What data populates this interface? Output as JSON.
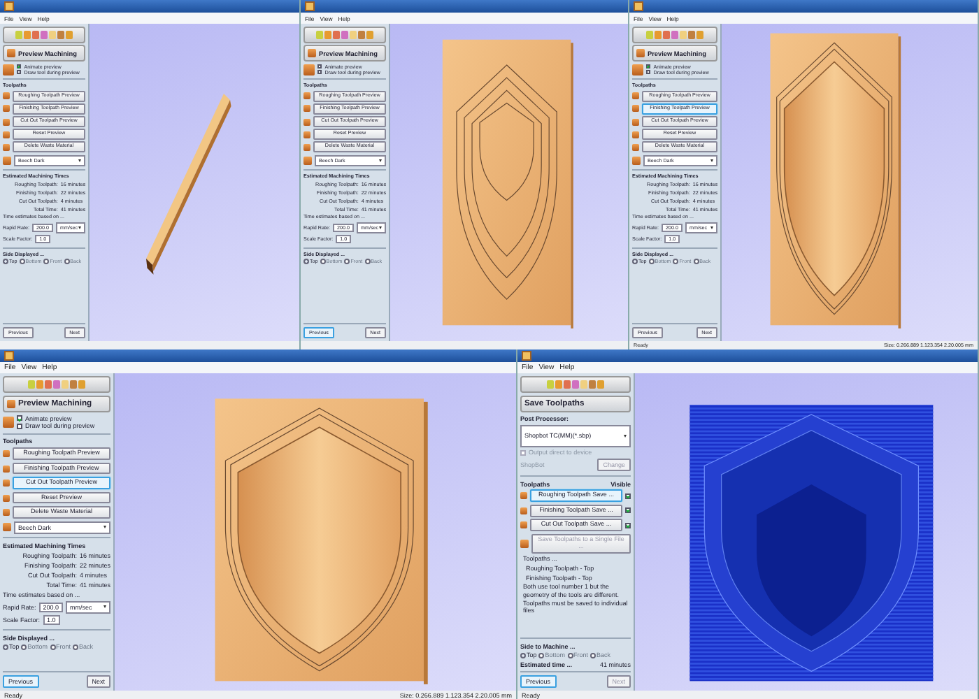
{
  "rows": [
    {
      "screens": [
        {
          "menu": [
            "File",
            "View",
            "Help"
          ],
          "view": {
            "kind": "stick"
          },
          "panel": {
            "kind": "preview",
            "title": "Preview Machining",
            "options": [
              {
                "label": "Animate preview",
                "checked": true
              },
              {
                "label": "Draw tool during preview",
                "checked": false
              }
            ],
            "toolpaths_heading": "Toolpaths",
            "toolpaths": [
              {
                "label": "Roughing Toolpath Preview",
                "selected": false
              },
              {
                "label": "Finishing Toolpath Preview",
                "selected": false
              },
              {
                "label": "Cut Out Toolpath Preview",
                "selected": false
              }
            ],
            "actions": [
              "Reset Preview",
              "Delete Waste Material"
            ],
            "material": "Beech Dark",
            "times_heading": "Estimated Machining Times",
            "times": [
              {
                "label": "Roughing Toolpath:",
                "value": "16 minutes"
              },
              {
                "label": "Finishing Toolpath:",
                "value": "22 minutes"
              },
              {
                "label": "Cut Out Toolpath:",
                "value": "4 minutes"
              },
              {
                "label": "Total Time:",
                "value": "41 minutes"
              }
            ],
            "estimate_note": "Time estimates based on ...",
            "rapid_label": "Rapid Rate:",
            "rapid_value": "200.0",
            "rapid_unit": "mm/sec",
            "scale_label": "Scale Factor:",
            "scale_value": "1.0",
            "sides_heading": "Side Displayed ...",
            "sides": [
              {
                "label": "Top",
                "selected": true
              },
              {
                "label": "Bottom",
                "selected": false
              },
              {
                "label": "Front",
                "selected": false
              },
              {
                "label": "Back",
                "selected": false
              }
            ],
            "buttons": [
              {
                "label": "Previous",
                "focused": false,
                "disabled": false
              },
              {
                "label": "Next",
                "focused": false,
                "disabled": false
              }
            ]
          }
        },
        {
          "menu": [
            "File",
            "View",
            "Help"
          ],
          "view": {
            "kind": "outlines"
          },
          "panel": {
            "kind": "preview",
            "title": "Preview Machining",
            "options": [
              {
                "label": "Animate preview",
                "checked": false
              },
              {
                "label": "Draw tool during preview",
                "checked": false
              }
            ],
            "toolpaths_heading": "Toolpaths",
            "toolpaths": [
              {
                "label": "Roughing Toolpath Preview",
                "selected": false
              },
              {
                "label": "Finishing Toolpath Preview",
                "selected": false
              },
              {
                "label": "Cut Out Toolpath Preview",
                "selected": false
              }
            ],
            "actions": [
              "Reset Preview",
              "Delete Waste Material"
            ],
            "material": "Beech Dark",
            "times_heading": "Estimated Machining Times",
            "times": [
              {
                "label": "Roughing Toolpath:",
                "value": "16 minutes"
              },
              {
                "label": "Finishing Toolpath:",
                "value": "22 minutes"
              },
              {
                "label": "Cut Out Toolpath:",
                "value": "4 minutes"
              },
              {
                "label": "Total Time:",
                "value": "41 minutes"
              }
            ],
            "estimate_note": "Time estimates based on ...",
            "rapid_label": "Rapid Rate:",
            "rapid_value": "200.0",
            "rapid_unit": "mm/sec",
            "scale_label": "Scale Factor:",
            "scale_value": "1.0",
            "sides_heading": "Side Displayed ...",
            "sides": [
              {
                "label": "Top",
                "selected": true
              },
              {
                "label": "Bottom",
                "selected": false
              },
              {
                "label": "Front",
                "selected": false
              },
              {
                "label": "Back",
                "selected": false
              }
            ],
            "buttons": [
              {
                "label": "Previous",
                "focused": true,
                "disabled": false
              },
              {
                "label": "Next",
                "focused": false,
                "disabled": false
              }
            ]
          }
        },
        {
          "menu": [
            "File",
            "View",
            "Help"
          ],
          "view": {
            "kind": "carved"
          },
          "status": {
            "left": "Ready",
            "right": "Size: 0.266.889 1.123.354 2.20.005 mm"
          },
          "panel": {
            "kind": "preview",
            "title": "Preview Machining",
            "options": [
              {
                "label": "Animate preview",
                "checked": true
              },
              {
                "label": "Draw tool during preview",
                "checked": false
              }
            ],
            "toolpaths_heading": "Toolpaths",
            "toolpaths": [
              {
                "label": "Roughing Toolpath Preview",
                "selected": false
              },
              {
                "label": "Finishing Toolpath Preview",
                "selected": true
              },
              {
                "label": "Cut Out Toolpath Preview",
                "selected": false
              }
            ],
            "actions": [
              "Reset Preview",
              "Delete Waste Material"
            ],
            "material": "Beech Dark",
            "times_heading": "Estimated Machining Times",
            "times": [
              {
                "label": "Roughing Toolpath:",
                "value": "16 minutes"
              },
              {
                "label": "Finishing Toolpath:",
                "value": "22 minutes"
              },
              {
                "label": "Cut Out Toolpath:",
                "value": "4 minutes"
              },
              {
                "label": "Total Time:",
                "value": "41 minutes"
              }
            ],
            "estimate_note": "Time estimates based on ...",
            "rapid_label": "Rapid Rate:",
            "rapid_value": "200.0",
            "rapid_unit": "mm/sec",
            "scale_label": "Scale Factor:",
            "scale_value": "1.0",
            "sides_heading": "Side Displayed ...",
            "sides": [
              {
                "label": "Top",
                "selected": true
              },
              {
                "label": "Bottom",
                "selected": false
              },
              {
                "label": "Front",
                "selected": false
              },
              {
                "label": "Back",
                "selected": false
              }
            ],
            "buttons": [
              {
                "label": "Previous",
                "focused": false,
                "disabled": false
              },
              {
                "label": "Next",
                "focused": false,
                "disabled": false
              }
            ]
          }
        }
      ]
    },
    {
      "screens": [
        {
          "menu": [
            "File",
            "View",
            "Help"
          ],
          "view": {
            "kind": "carved"
          },
          "status": {
            "left": "Ready",
            "right": "Size: 0.266.889 1.123.354 2.20.005 mm"
          },
          "panel": {
            "kind": "preview",
            "title": "Preview Machining",
            "options": [
              {
                "label": "Animate preview",
                "checked": true
              },
              {
                "label": "Draw tool during preview",
                "checked": false
              }
            ],
            "toolpaths_heading": "Toolpaths",
            "toolpaths": [
              {
                "label": "Roughing Toolpath Preview",
                "selected": false
              },
              {
                "label": "Finishing Toolpath Preview",
                "selected": false
              },
              {
                "label": "Cut Out Toolpath Preview",
                "selected": true
              }
            ],
            "actions": [
              "Reset Preview",
              "Delete Waste Material"
            ],
            "material": "Beech Dark",
            "times_heading": "Estimated Machining Times",
            "times": [
              {
                "label": "Roughing Toolpath:",
                "value": "16 minutes"
              },
              {
                "label": "Finishing Toolpath:",
                "value": "22 minutes"
              },
              {
                "label": "Cut Out Toolpath:",
                "value": "4 minutes"
              },
              {
                "label": "Total Time:",
                "value": "41 minutes"
              }
            ],
            "estimate_note": "Time estimates based on ...",
            "rapid_label": "Rapid Rate:",
            "rapid_value": "200.0",
            "rapid_unit": "mm/sec",
            "scale_label": "Scale Factor:",
            "scale_value": "1.0",
            "sides_heading": "Side Displayed ...",
            "sides": [
              {
                "label": "Top",
                "selected": true
              },
              {
                "label": "Bottom",
                "selected": false
              },
              {
                "label": "Front",
                "selected": false
              },
              {
                "label": "Back",
                "selected": false
              }
            ],
            "buttons": [
              {
                "label": "Previous",
                "focused": true,
                "disabled": false
              },
              {
                "label": "Next",
                "focused": false,
                "disabled": false
              }
            ]
          }
        },
        {
          "menu": [
            "File",
            "View",
            "Help"
          ],
          "view": {
            "kind": "blue"
          },
          "status": {
            "left": "Ready"
          },
          "panel": {
            "kind": "save",
            "title": "Save Toolpaths",
            "post_label": "Post Processor:",
            "post_value": "Shopbot TC(MM)(*.sbp)",
            "output_option": {
              "label": "Output direct to device",
              "checked": false
            },
            "device": "ShopBot",
            "change": "Change",
            "toolpaths_heading": "Toolpaths",
            "visible_heading": "Visible",
            "toolpaths": [
              {
                "label": "Roughing Toolpath Save ...",
                "selected": true,
                "visible": true
              },
              {
                "label": "Finishing Toolpath Save ...",
                "selected": false,
                "visible": true
              },
              {
                "label": "Cut Out Toolpath Save ...",
                "selected": false,
                "visible": true
              }
            ],
            "single_file": "Save Toolpaths to a Single File ...",
            "notes": [
              "Toolpaths ...",
              "Roughing Toolpath - Top",
              "Finishing Toolpath - Top",
              "Both use tool number 1 but the geometry of the tools are different.",
              "Toolpaths must be saved to individual files"
            ],
            "sides_heading": "Side to Machine ...",
            "sides": [
              {
                "label": "Top",
                "selected": true
              },
              {
                "label": "Bottom",
                "selected": false
              },
              {
                "label": "Front",
                "selected": false
              },
              {
                "label": "Back",
                "selected": false
              }
            ],
            "time_label": "Estimated time ...",
            "time_value": "41 minutes",
            "buttons": [
              {
                "label": "Previous",
                "focused": true,
                "disabled": false
              },
              {
                "label": "Next",
                "focused": false,
                "disabled": true
              }
            ]
          }
        }
      ]
    }
  ]
}
